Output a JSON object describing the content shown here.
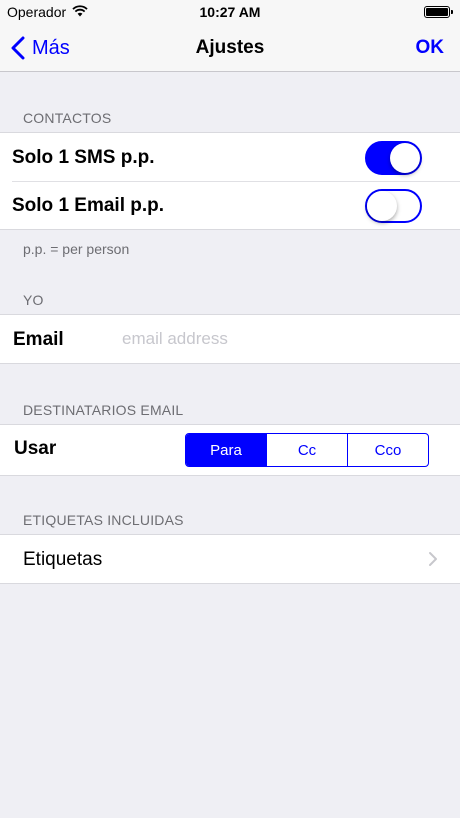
{
  "status_bar": {
    "carrier": "Operador",
    "time": "10:27 AM"
  },
  "nav": {
    "back_label": "Más",
    "title": "Ajustes",
    "done_label": "OK"
  },
  "sections": {
    "contactos": {
      "header": "CONTACTOS",
      "rows": [
        {
          "label": "Solo 1 SMS p.p.",
          "on": true
        },
        {
          "label": "Solo 1 Email p.p.",
          "on": false
        }
      ],
      "footer": "p.p. = per person"
    },
    "yo": {
      "header": "YO",
      "email_label": "Email",
      "email_value": "",
      "email_placeholder": "email address"
    },
    "destinatarios": {
      "header": "DESTINATARIOS EMAIL",
      "usar_label": "Usar",
      "segments": [
        "Para",
        "Cc",
        "Cco"
      ],
      "selected_index": 0
    },
    "etiquetas": {
      "header": "ETIQUETAS INCLUIDAS",
      "row_label": "Etiquetas"
    }
  },
  "colors": {
    "accent": "#0000ff",
    "background": "#efeff4",
    "section_text": "#6d6d72",
    "placeholder": "#c7c7cd"
  },
  "icons": [
    "wifi-icon",
    "battery-icon",
    "chevron-left-icon",
    "chevron-right-icon"
  ]
}
